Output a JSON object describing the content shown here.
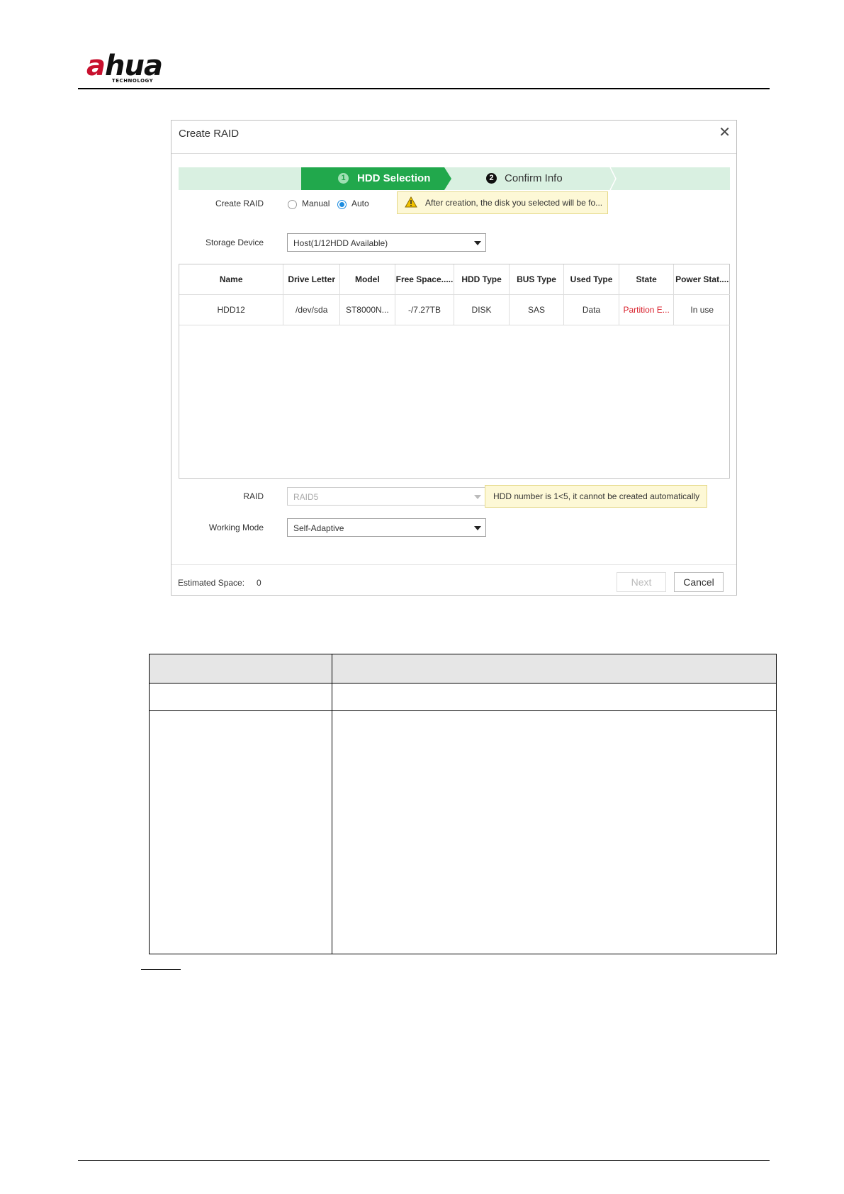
{
  "header": {
    "logo_text_a": "a",
    "logo_text_rest": "hua",
    "logo_sub": "TECHNOLOGY"
  },
  "dialog": {
    "title": "Create RAID",
    "close_icon": "close-icon",
    "steps": [
      {
        "num": "1",
        "label": "HDD Selection",
        "active": true
      },
      {
        "num": "2",
        "label": "Confirm Info",
        "active": false
      }
    ],
    "create_raid": {
      "label": "Create RAID",
      "options": [
        {
          "label": "Manual",
          "selected": false
        },
        {
          "label": "Auto",
          "selected": true
        }
      ],
      "tip": "After creation, the disk you selected will be fo..."
    },
    "storage_device": {
      "label": "Storage Device",
      "value": "Host(1/12HDD Available)"
    },
    "grid": {
      "columns": [
        "Name",
        "Drive Letter",
        "Model",
        "Free Space.....",
        "HDD Type",
        "BUS Type",
        "Used Type",
        "State",
        "Power Stat...."
      ],
      "rows": [
        [
          "HDD12",
          "/dev/sda",
          "ST8000N...",
          "-/7.27TB",
          "DISK",
          "SAS",
          "Data",
          "Partition E...",
          "In use"
        ]
      ]
    },
    "raid": {
      "label": "RAID",
      "value": "RAID5",
      "tip": "HDD number is 1<5, it cannot be created automatically"
    },
    "working_mode": {
      "label": "Working Mode",
      "value": "Self-Adaptive"
    },
    "estimated_space": {
      "label": "Estimated Space:",
      "value": "0"
    },
    "buttons": {
      "next": "Next",
      "cancel": "Cancel"
    },
    "colors": {
      "accent_green": "#21a84c",
      "step_bg": "#d9f0e1",
      "state_error": "#d9232e",
      "radio_selected": "#1c8ce0"
    }
  },
  "doc_table": {
    "header": [
      "",
      ""
    ],
    "rows": [
      [
        "",
        ""
      ],
      [
        "",
        ""
      ]
    ]
  }
}
